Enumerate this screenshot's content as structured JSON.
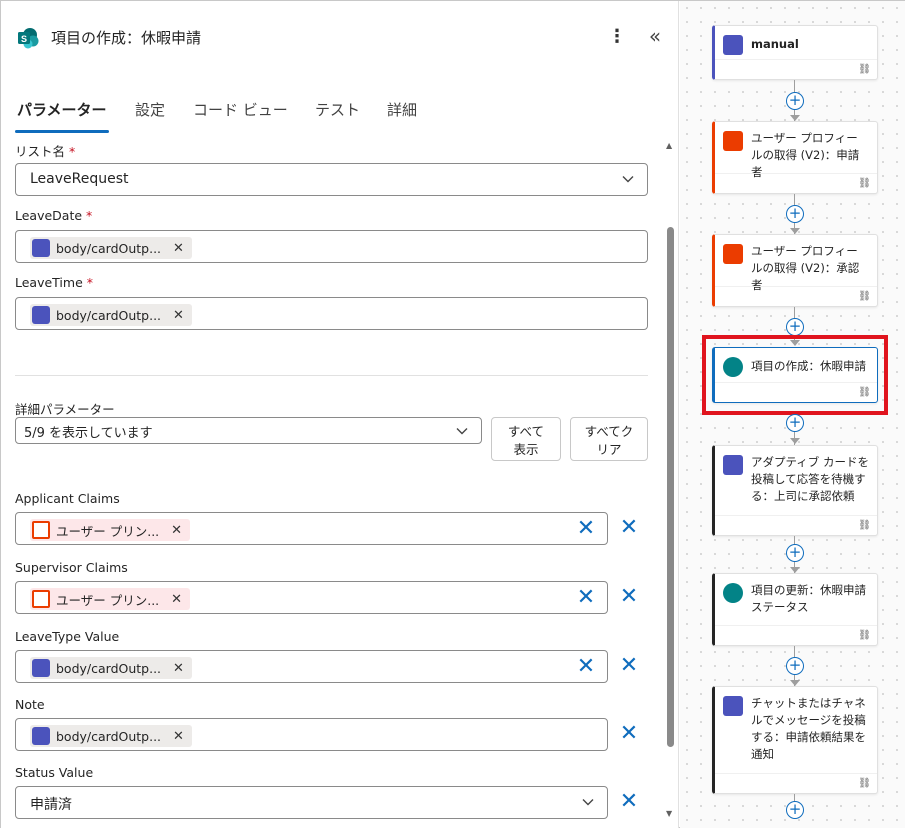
{
  "header": {
    "title": "項目の作成：休暇申請"
  },
  "tabs": [
    {
      "label": "パラメーター",
      "active": true
    },
    {
      "label": "設定"
    },
    {
      "label": "コード ビュー"
    },
    {
      "label": "テスト"
    },
    {
      "label": "詳細"
    }
  ],
  "fields": {
    "list_name": {
      "label": "リスト名",
      "required": "*",
      "value": "LeaveRequest"
    },
    "leave_date": {
      "label": "LeaveDate",
      "required": "*",
      "token": "body/cardOutp..."
    },
    "leave_time": {
      "label": "LeaveTime",
      "required": "*",
      "token": "body/cardOutp..."
    }
  },
  "advanced": {
    "label": "詳細パラメーター",
    "value": "5/9 を表示しています",
    "show_all": "すべて\n表示",
    "clear_all": "すべてク\nリア"
  },
  "adv_fields": [
    {
      "label": "Applicant Claims",
      "token": "ユーザー プリン...",
      "kind": "o365"
    },
    {
      "label": "Supervisor Claims",
      "token": "ユーザー プリン...",
      "kind": "o365"
    },
    {
      "label": "LeaveType Value",
      "token": "body/cardOutp...",
      "kind": "teams"
    },
    {
      "label": "Note",
      "token": "body/cardOutp...",
      "kind": "teams"
    }
  ],
  "status": {
    "label": "Status Value",
    "value": "申請済"
  },
  "flow": [
    {
      "title": "manual",
      "type": "teams",
      "color": "#4b53bc",
      "bold": true
    },
    {
      "title": "ユーザー プロフィールの取得 (V2)：申請者",
      "type": "o365",
      "color": "#eb3c00"
    },
    {
      "title": "ユーザー プロフィールの取得 (V2)：承認者",
      "type": "o365",
      "color": "#eb3c00"
    },
    {
      "title": "項目の作成：休暇申請",
      "type": "sharepoint",
      "color": "#038387",
      "selected": true
    },
    {
      "title": "アダプティブ カードを投稿して応答を待機する：上司に承認依頼",
      "type": "teams",
      "color": "#242424"
    },
    {
      "title": "項目の更新：休暇申請ステータス",
      "type": "sharepoint",
      "color": "#242424"
    },
    {
      "title": "チャットまたはチャネルでメッセージを投稿する：申請依頼結果を通知",
      "type": "teams",
      "color": "#242424"
    }
  ]
}
